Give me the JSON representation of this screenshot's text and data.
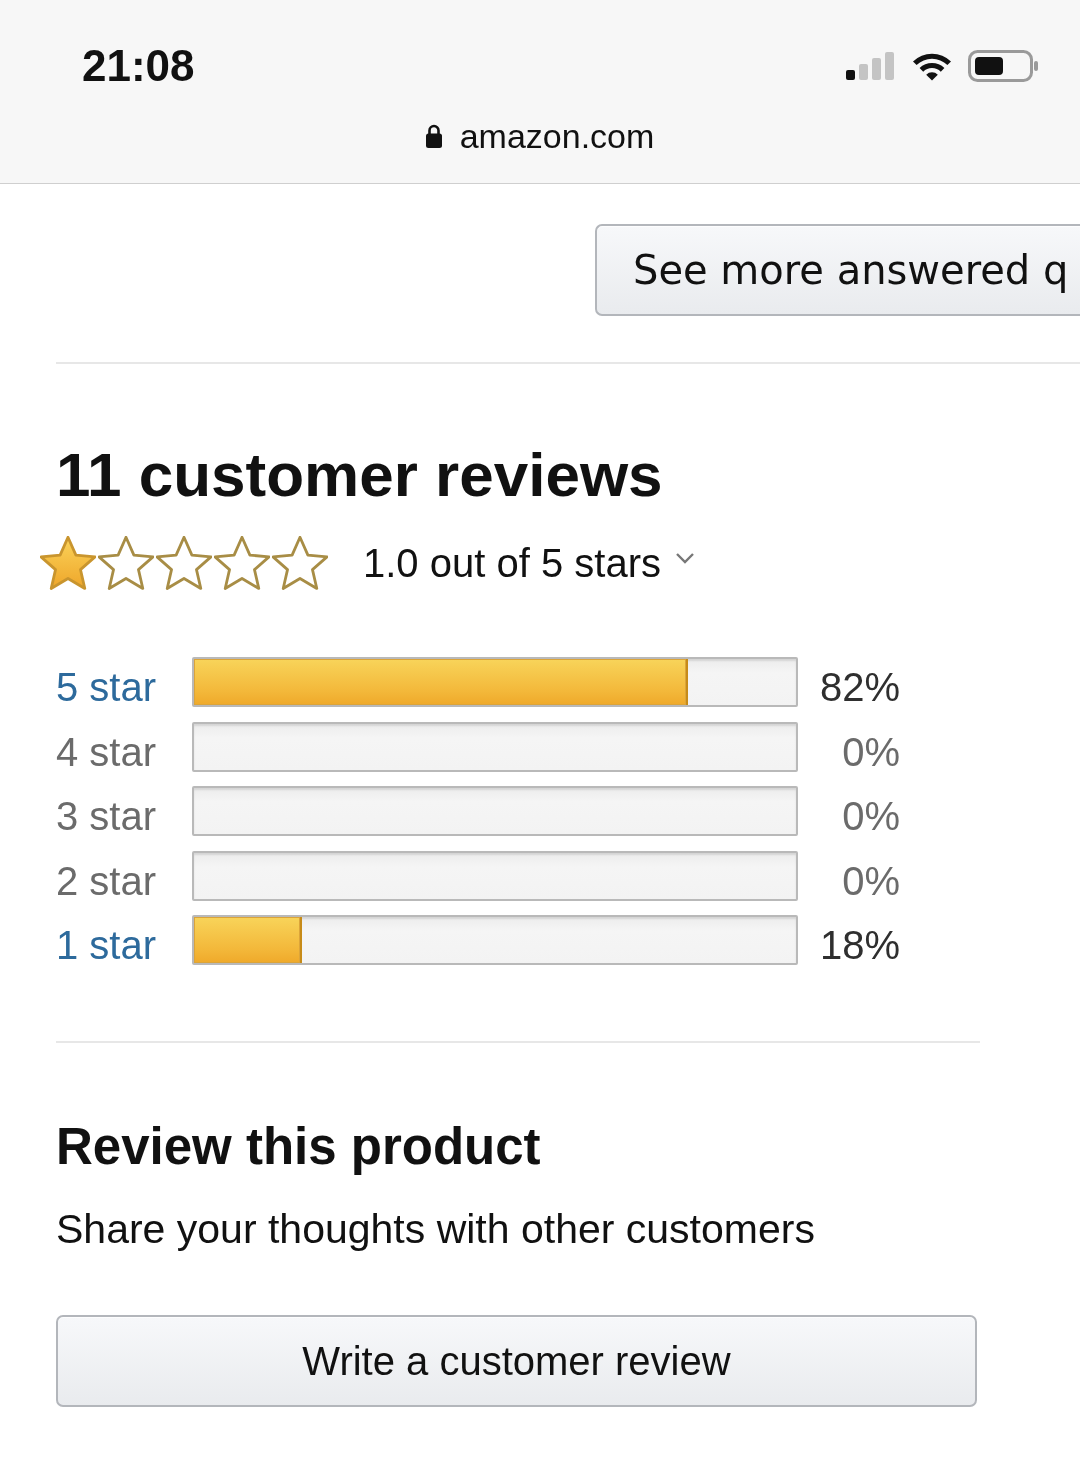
{
  "status_bar": {
    "time": "21:08"
  },
  "address_bar": {
    "url": "amazon.com"
  },
  "questions": {
    "see_more_button": "See more answered q"
  },
  "reviews": {
    "title": "11 customer reviews",
    "stars": 1,
    "rating_summary": "1.0 out of 5 stars",
    "histogram": [
      {
        "label": "5 star",
        "link": true,
        "level": 0.82,
        "percent": "82%"
      },
      {
        "label": "4 star",
        "link": false,
        "percent": "0%"
      },
      {
        "label": "3 star",
        "link": false,
        "percent": "0%"
      },
      {
        "label": "2 star",
        "link": false,
        "percent": "0%"
      },
      {
        "label": "1 star",
        "link": true,
        "level": 0.18,
        "percent": "18%"
      }
    ]
  },
  "review_product": {
    "title": "Review this product",
    "prompt": "Share your thoughts with other customers",
    "button": "Write a customer review"
  }
}
